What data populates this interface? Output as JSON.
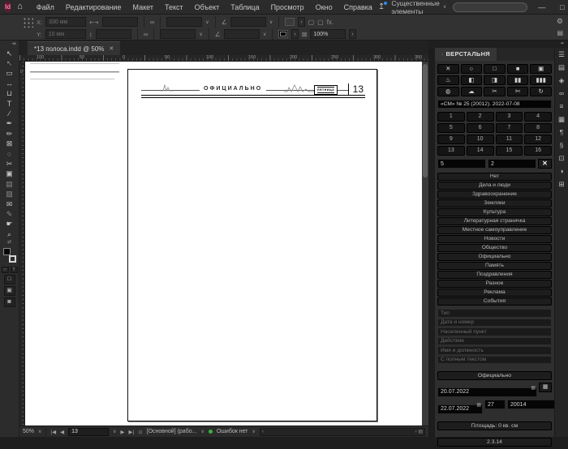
{
  "menubar": {
    "logo": "Id",
    "items": [
      "Файл",
      "Редактирование",
      "Макет",
      "Текст",
      "Объект",
      "Таблица",
      "Просмотр",
      "Окно",
      "Справка"
    ],
    "workspace": "Существенные элементы",
    "search_value": ""
  },
  "icons": {
    "home": "⌂",
    "share": "↥",
    "chevron_down": "∨",
    "minimize": "—",
    "restore": "□",
    "close": "✕",
    "gear": "⚙",
    "panel_layout": "▤",
    "collapse_right": "↠",
    "collapse_left": "«",
    "link": "∞",
    "width": "⟷",
    "height": "↕",
    "rotate": "∠",
    "shear": "∠",
    "corner": "▢",
    "frame_fit": "▢",
    "fx": "fx.",
    "opacity_box": "⊠",
    "first_page": "|◀",
    "prev_page": "◀",
    "next_page": "▶",
    "last_page": "▶|",
    "preflight": "⊙",
    "scroll_left": "‹",
    "scroll_right": "›",
    "pages_mini": "▤",
    "calendar": "▦",
    "picker1": "▦",
    "picker2": "▥",
    "clear_x": "✕"
  },
  "controlbar": {
    "x_label": "X:",
    "x_value": "330 мм",
    "y_label": "Y:",
    "y_value": "10 мм",
    "opacity_value": "100%"
  },
  "tools": {
    "glyphs": [
      "↖",
      "↖",
      "▭",
      "↔",
      "⊔",
      "T",
      "∕",
      "✒",
      "✏",
      "⊠",
      "○",
      "✂",
      "▣",
      "▤",
      "▨",
      "✉",
      "✎",
      "☛",
      "⌕"
    ],
    "fmt1": "□",
    "fmt2": "T",
    "none": "□",
    "screen1": "▣",
    "screen2": "◙",
    "swap": "⇄"
  },
  "tab": {
    "title": "*13 полоса.indd @ 50%",
    "close": "✕"
  },
  "rulers": {
    "horizontal": [
      "100",
      "50",
      "0",
      "50",
      "100",
      "150",
      "200",
      "250",
      "300",
      "350"
    ],
    "vertical_zero": "0"
  },
  "page": {
    "header_title": "ОФИЦИАЛЬНО",
    "nameplate": "пятница",
    "page_number": "13"
  },
  "panel": {
    "title": "ВЕРСТАЛЬНЯ",
    "tab_dot": "◦",
    "tool_glyphs": [
      "✕",
      "○",
      "□",
      "■",
      "▣",
      "♨",
      "◧",
      "◨",
      "▮▮",
      "▮▮▮",
      "◍",
      "☁",
      "✂",
      "✄",
      "↻"
    ],
    "issue_label": "«СМ» № 25 (20012). 2022-07-08",
    "page_numbers": [
      "1",
      "2",
      "3",
      "4",
      "5",
      "6",
      "7",
      "8",
      "9",
      "10",
      "11",
      "12",
      "13",
      "14",
      "15",
      "16"
    ],
    "field_left": "5",
    "field_right": "2",
    "categories": [
      "Нет",
      "Дела и люди",
      "Здравоохранение",
      "Земляки",
      "Культура",
      "Литературная страничка",
      "Местное самоуправление",
      "Новости",
      "Общество",
      "Официально",
      "Память",
      "Поздравления",
      "Разное",
      "Реклама",
      "События"
    ],
    "meta": [
      "Тип",
      "Дата и номер",
      "Населенный пункт",
      "Действие",
      "Имя и должность",
      "С полным текстом"
    ],
    "rubric_button": "Официально",
    "date_value": "20.07.2022",
    "date2_value": "22.07.2022",
    "num1": "27",
    "num2": "20014",
    "area_button": "Площадь: 0 кв. см",
    "version": "2.3.14"
  },
  "statusbar": {
    "zoom": "50%",
    "page_field": "13",
    "preset": "[Основной] (рабо...",
    "errors": "Ошибок нет"
  }
}
